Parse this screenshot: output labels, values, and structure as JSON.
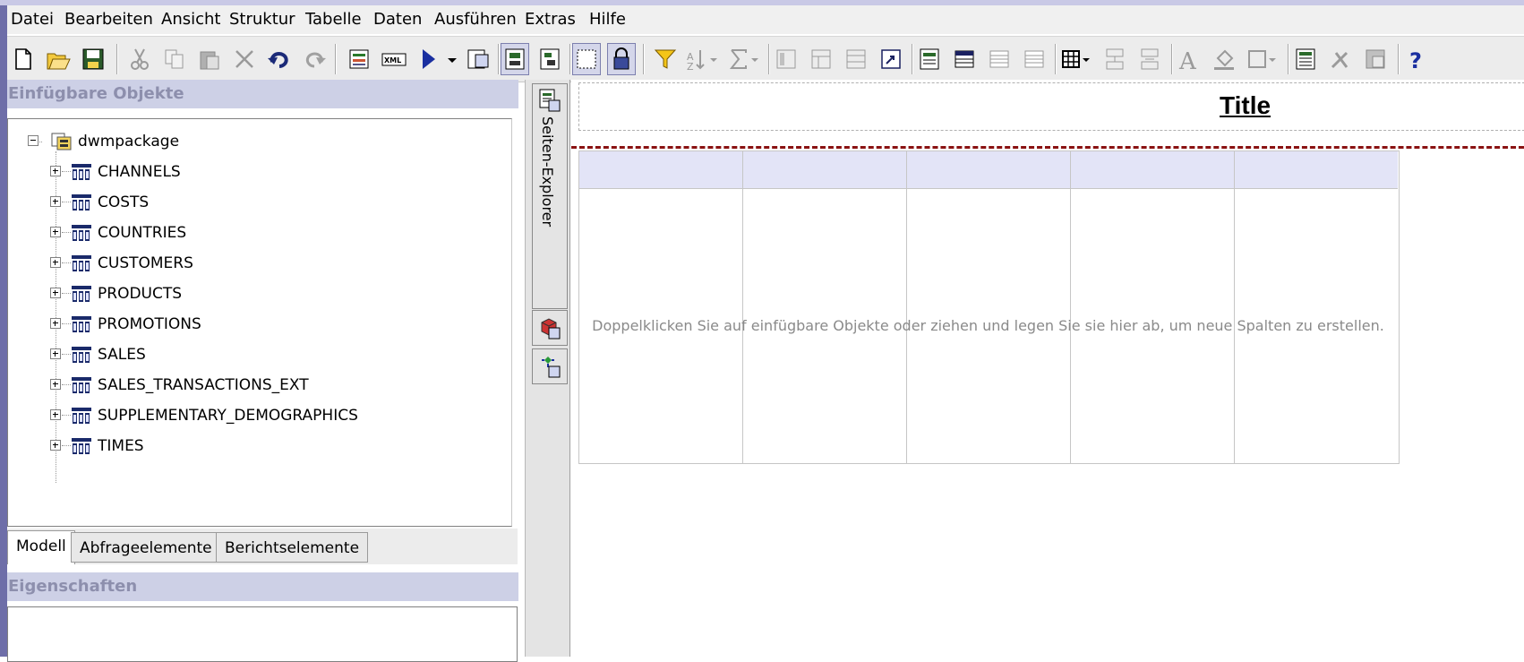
{
  "menu": [
    "Datei",
    "Bearbeiten",
    "Ansicht",
    "Struktur",
    "Tabelle",
    "Daten",
    "Ausführen",
    "Extras",
    "Hilfe"
  ],
  "toolbar_icons": [
    "new-file-icon",
    "open-folder-icon",
    "save-icon",
    "cut-icon",
    "copy-icon",
    "paste-icon",
    "delete-icon",
    "undo-icon",
    "redo-icon",
    "report-icon",
    "xml-icon",
    "run-icon",
    "run-dropdown-icon",
    "view-icon",
    "layout-icon",
    "structure-icon",
    "select-icon",
    "lock-icon",
    "filter-icon",
    "sort-icon",
    "sum-icon",
    "align-icon",
    "group-icon",
    "section-icon",
    "pivot-icon",
    "list-icon",
    "header-icon",
    "body-icon",
    "footer-icon",
    "table-icon",
    "merge-icon",
    "split-icon",
    "font-icon",
    "fill-icon",
    "border-icon",
    "properties-icon",
    "tools-icon",
    "calc-icon",
    "help-icon"
  ],
  "insertable": {
    "header": "Einfügbare Objekte",
    "root": "dwmpackage",
    "items": [
      "CHANNELS",
      "COSTS",
      "COUNTRIES",
      "CUSTOMERS",
      "PRODUCTS",
      "PROMOTIONS",
      "SALES",
      "SALES_TRANSACTIONS_EXT",
      "SUPPLEMENTARY_DEMOGRAPHICS",
      "TIMES"
    ]
  },
  "tabs": [
    "Modell",
    "Abfrageelemente",
    "Berichtselemente"
  ],
  "properties": {
    "header": "Eigenschaften"
  },
  "side": {
    "explorer_label": "Seiten-Explorer"
  },
  "canvas": {
    "title": "Title",
    "hint": "Doppelklicken Sie auf einfügbare Objekte oder ziehen und legen Sie sie hier ab, um neue Spalten zu erstellen."
  },
  "colors": {
    "accent": "#cdd0e6",
    "header_fill": "#e3e4f7",
    "page_break": "#8a1212"
  }
}
